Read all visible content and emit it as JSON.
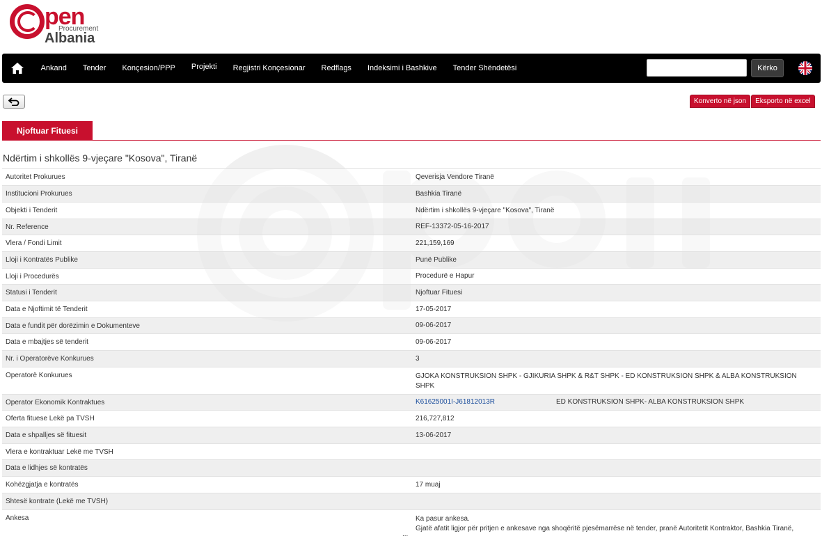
{
  "logo": {
    "big": "pen",
    "small": "Procurement",
    "country": "Albania"
  },
  "nav": {
    "items": [
      "Ankand",
      "Tender",
      "Konçesion/PPP",
      "Projekti",
      "Regjistri Konçesionar",
      "Redflags",
      "Indeksimi i Bashkive",
      "Tender Shëndetësi"
    ],
    "search_button": "Kërko",
    "search_value": ""
  },
  "actions": {
    "json": "Konverto në json",
    "excel": "Eksporto në excel"
  },
  "tab": "Njoftuar Fituesi",
  "title": "Ndërtim i shkollës 9-vjeçare \"Kosova\", Tiranë",
  "rows": [
    {
      "label": "Autoritet Prokurues",
      "value": "Qeverisja Vendore Tiranë"
    },
    {
      "label": "Institucioni Prokurues",
      "value": "Bashkia Tiranë"
    },
    {
      "label": "Objekti i Tenderit",
      "value": "Ndërtim i shkollës 9-vjeçare \"Kosova\", Tiranë"
    },
    {
      "label": "Nr. Reference",
      "value": "REF-13372-05-16-2017"
    },
    {
      "label": "Vlera / Fondi Limit",
      "value": "221,159,169"
    },
    {
      "label": "Lloji i Kontratës Publike",
      "value": "Punë Publike"
    },
    {
      "label": "Lloji i Procedurës",
      "value": "Procedurë e Hapur"
    },
    {
      "label": "Statusi i Tenderit",
      "value": "Njoftuar Fituesi"
    },
    {
      "label": "Data e Njoftimit të Tenderit",
      "value": "17-05-2017"
    },
    {
      "label": "Data e fundit për dorëzimin e Dokumenteve",
      "value": "09-06-2017"
    },
    {
      "label": "Data e mbajtjes së tenderit",
      "value": "09-06-2017"
    },
    {
      "label": "Nr. i Operatorëve Konkurues",
      "value": "3"
    },
    {
      "label": "Operatorë Konkurues",
      "value": "GJOKA KONSTRUKSION SHPK - GJIKURIA SHPK & R&T SHPK - ED KONSTRUKSION SHPK & ALBA KONSTRUKSION SHPK"
    },
    {
      "label": "Operator Ekonomik Kontraktues",
      "code": "K61625001I-J61812013R",
      "value": "ED KONSTRUKSION SHPK- ALBA KONSTRUKSION SHPK"
    },
    {
      "label": "Oferta fituese Lekë pa TVSH",
      "value": "216,727,812"
    },
    {
      "label": "Data e shpalljes së fituesit",
      "value": "13-06-2017"
    },
    {
      "label": "Vlera e kontraktuar Lekë me TVSH",
      "value": ""
    },
    {
      "label": "Data e lidhjes së kontratës",
      "value": ""
    },
    {
      "label": "Kohëzgjatja e kontratës",
      "value": "17 muaj"
    },
    {
      "label": "Shtesë kontrate (Lekë me TVSH)",
      "value": ""
    },
    {
      "label": "Ankesa",
      "value": "Ka pasur ankesa.",
      "value2": "Gjatë afatit ligjor për pritjen e ankesave nga shoqëritë pjesëmarrëse në tender, pranë Autoritetit Kontraktor, Bashkia Tiranë,"
    }
  ],
  "colors": {
    "accent": "#c8102e",
    "navbar": "#000000",
    "link": "#1a4d9c"
  },
  "icons": [
    "home-icon",
    "uk-flag-icon",
    "back-arrow-icon"
  ]
}
